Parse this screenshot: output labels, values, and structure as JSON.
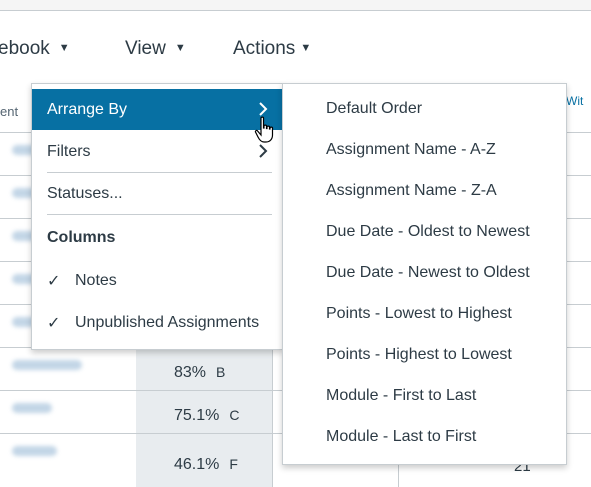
{
  "menubar": {
    "items": [
      {
        "label": "ebook",
        "caret": "▼"
      },
      {
        "label": "View",
        "caret": "▼"
      },
      {
        "label": "Actions",
        "caret": "▼"
      }
    ]
  },
  "grid": {
    "header_left": "ent",
    "header_right": "Wit",
    "rows": [
      {
        "grade": "",
        "letter": ""
      },
      {
        "grade": "",
        "letter": ""
      },
      {
        "grade": "",
        "letter": ""
      },
      {
        "grade": "",
        "letter": ""
      },
      {
        "grade": "",
        "letter": ""
      },
      {
        "grade": "83%",
        "letter": "B"
      },
      {
        "grade": "75.1%",
        "letter": "C"
      },
      {
        "grade": "46.1%",
        "letter": "F"
      }
    ],
    "trailing_value": "21"
  },
  "view_menu": {
    "arrange_by": "Arrange By",
    "filters": "Filters",
    "statuses": "Statuses...",
    "columns_heading": "Columns",
    "notes": "Notes",
    "unpublished": "Unpublished Assignments",
    "check_glyph": "✓"
  },
  "arrange_submenu": [
    "Default Order",
    "Assignment Name - A-Z",
    "Assignment Name - Z-A",
    "Due Date - Oldest to Newest",
    "Due Date - Newest to Oldest",
    "Points - Lowest to Highest",
    "Points - Highest to Lowest",
    "Module - First to Last",
    "Module - Last to First"
  ],
  "colors": {
    "accent": "#0770a3",
    "text": "#2d3b45",
    "border": "#c7cdd1"
  },
  "icons": {
    "chevron": "chevron-right-icon",
    "check": "checkmark-icon",
    "cursor": "hand-pointer-icon"
  }
}
